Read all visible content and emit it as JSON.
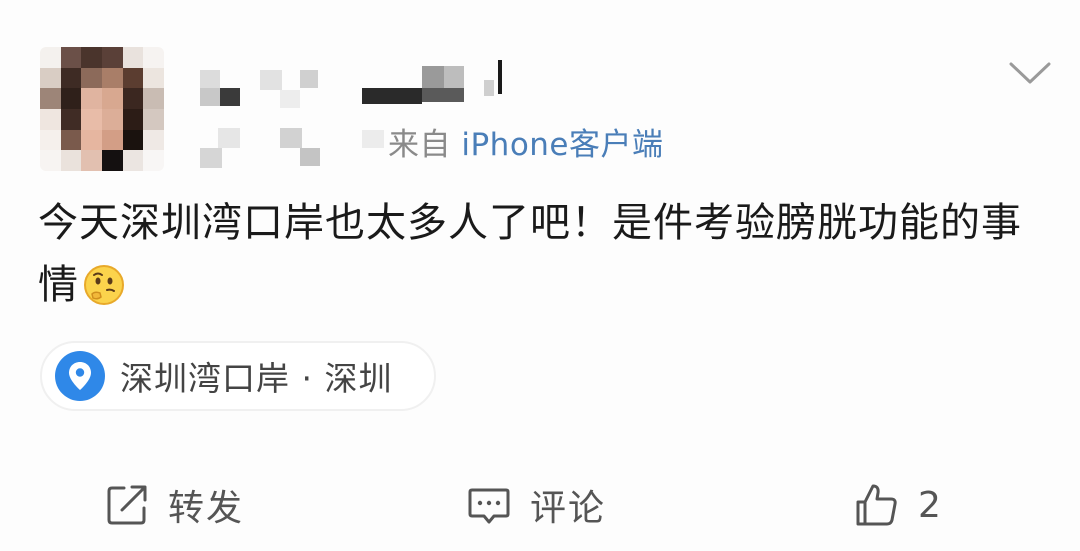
{
  "post": {
    "source_prefix": "来自",
    "source_client": "iPhone客户端",
    "content_text": "今天深圳湾口岸也太多人了吧！是件考验膀胱功能的事情",
    "emoji_icon": "thinking-face-icon",
    "location": {
      "icon": "location-pin-icon",
      "label": "深圳湾口岸 · 深圳"
    }
  },
  "actions": {
    "repost_label": "转发",
    "comment_label": "评论",
    "like_count": "2"
  },
  "colors": {
    "accent_blue": "#4a7eb8",
    "pin_blue": "#2f88e8",
    "text_main": "#1a1a1a",
    "text_muted": "#8a8a8a"
  }
}
